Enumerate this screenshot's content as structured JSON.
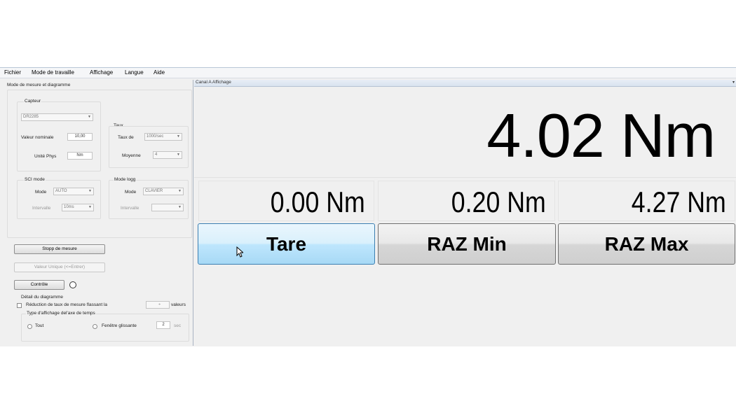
{
  "menu": [
    "Fichier",
    "Mode de travaille",
    "Affichage",
    "Langue",
    "Aide"
  ],
  "left": {
    "section_title": "Mode de mesure et diagramme",
    "capteur": {
      "group_label": "Capteur",
      "sensor_value": "DR2285",
      "nominal_label": "Valeur nominale",
      "nominal_value": "10,00",
      "unit_label": "Unité Phys",
      "unit_value": "Nm"
    },
    "taux": {
      "group_label": "Taux",
      "rate_label": "Taux de",
      "rate_value": "1000/sec",
      "avg_label": "Moyenne",
      "avg_value": "4"
    },
    "sci": {
      "group_label": "SCI mode",
      "mode_label": "Mode",
      "mode_value": "AUTO",
      "interval_label": "Intervalle",
      "interval_value": "10ms"
    },
    "logg": {
      "group_label": "Mode logg",
      "mode_label": "Mode",
      "mode_value": "CLAVIER",
      "interval_label": "Intervalle",
      "interval_value": ""
    },
    "stop_button": "Stopp de mesure",
    "single_button": "Valeur Unique (<=Entrer)",
    "control_button": "Contrôle",
    "diagram_label": "Détail du diagramme",
    "reduction_label": "Réduction de taux de mesure flassant la",
    "reduction_value": "",
    "values_label": "valeurs",
    "time_axis_label": "Type d'affichage del'axe de temps",
    "radio_all": "Tout",
    "radio_window": "Fenêtre glissante",
    "window_value": "2",
    "window_unit": "sec"
  },
  "right": {
    "panel_title": "Canal A Affichage",
    "main_value": "4.02 Nm",
    "values": [
      "0.00 Nm",
      "0.20 Nm",
      "4.27 Nm"
    ],
    "buttons": [
      "Tare",
      "RAZ Min",
      "RAZ Max"
    ]
  }
}
